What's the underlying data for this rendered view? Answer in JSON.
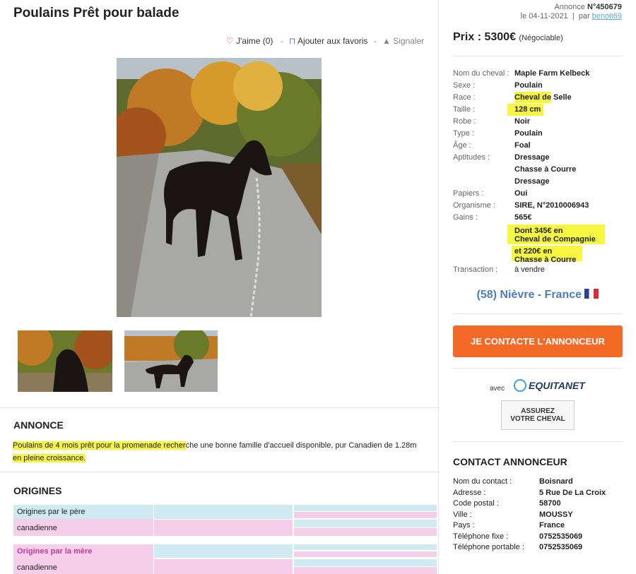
{
  "title": "Poulains Prêt pour balade",
  "actions": {
    "like_label": "J'aime",
    "like_count": "(0)",
    "favorites_label": "Ajouter aux favoris",
    "report_label": "Signaler",
    "separator": "-"
  },
  "annonce": {
    "label": "Annonce",
    "number": "N°450679",
    "date_prefix": "le",
    "date": "04-11-2021",
    "separator": "|",
    "by_prefix": "par",
    "author": "benoit69"
  },
  "price": {
    "label": "Prix :",
    "value": "5300€",
    "note": "(Négociable)"
  },
  "specs": [
    {
      "label": "Nom du cheval :",
      "value": "Maple Farm Kelbeck"
    },
    {
      "label": "Sexe :",
      "value": "Poulain"
    },
    {
      "label": "Race :",
      "value": "Cheval de Selle"
    },
    {
      "label": "Taille :",
      "value": "128 cm"
    },
    {
      "label": "Robe :",
      "value": "Noir"
    },
    {
      "label": "Type :",
      "value": "Poulain"
    },
    {
      "label": "Âge :",
      "value": "Foal"
    },
    {
      "label": "Aptitudes :",
      "value": "Dressage"
    },
    {
      "label": "",
      "value": "Chasse à Courre"
    },
    {
      "label": "",
      "value": "Dressage"
    },
    {
      "label": "Papiers :",
      "value": "Oui"
    },
    {
      "label": "Organisme :",
      "value": "SIRE, N°2010006943"
    }
  ],
  "gains": {
    "label": "Gains :",
    "total": "565€",
    "detail1a": "Dont 345€ en",
    "detail1b": "Cheval de Compagnie",
    "detail2a": "et 220€ en",
    "detail2b": "Chasse à Courre"
  },
  "transaction": {
    "label": "Transaction :",
    "value": "à vendre"
  },
  "location": "(58) Nièvre - France",
  "contact_button": "JE CONTACTE L'ANNONCEUR",
  "avec": "avec",
  "equitanet": "EQUITANET",
  "assurez_line1": "ASSUREZ",
  "assurez_line2": "VOTRE CHEVAL",
  "annonce_section": {
    "heading": "ANNONCE",
    "text_part1": "Poulains de 4 mois prêt pour la promenade recher",
    "text_part2": "che une bonne famille d'accueil disponible, pur Canadien de 1.28m",
    "text_part3": "en pleine croissance."
  },
  "origines": {
    "heading": "ORIGINES",
    "pere_label": "Origines par le père",
    "pere_value": "canadienne",
    "mere_label": "Origines par la mère",
    "mere_value": "canadienne"
  },
  "contact_section": {
    "heading": "CONTACT ANNONCEUR",
    "rows": [
      {
        "label": "Nom du contact :",
        "value": "Boisnard"
      },
      {
        "label": "Adresse :",
        "value": "5 Rue De La Croix"
      },
      {
        "label": "Code postal :",
        "value": "58700"
      },
      {
        "label": "Ville :",
        "value": "MOUSSY"
      },
      {
        "label": "Pays :",
        "value": "France"
      },
      {
        "label": "Téléphone fixe :",
        "value": "0752535069"
      },
      {
        "label": "Téléphone portable :",
        "value": "0752535069"
      }
    ]
  },
  "colors": {
    "accent_orange": "#f26a26",
    "location_blue": "#4a7fb5",
    "highlight_yellow": "#f5f542",
    "pere_blue": "#cfeaf0",
    "mere_pink": "#f5cfea"
  }
}
